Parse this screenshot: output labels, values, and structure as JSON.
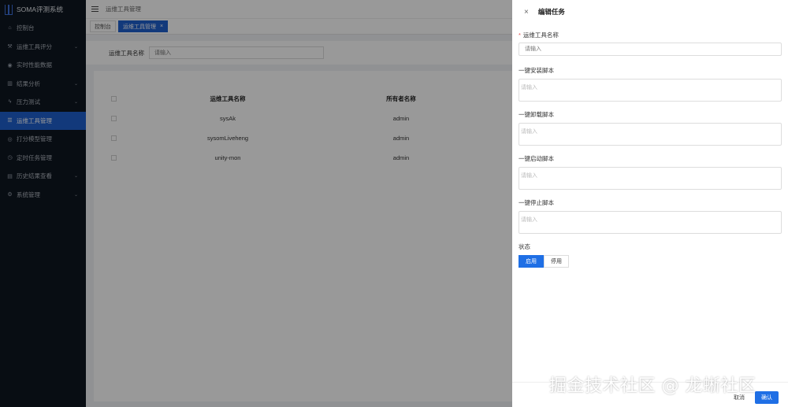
{
  "sidebar": {
    "title": "SOMA评测系统",
    "items": [
      {
        "label": "控制台",
        "icon": "home-icon",
        "glyph": "⌂",
        "expandable": false,
        "active": false
      },
      {
        "label": "运维工具评分",
        "icon": "tool-icon",
        "glyph": "⚒",
        "expandable": true,
        "active": false
      },
      {
        "label": "实时性能数据",
        "icon": "monitor-icon",
        "glyph": "◉",
        "expandable": false,
        "active": false
      },
      {
        "label": "结果分析",
        "icon": "chart-icon",
        "glyph": "▥",
        "expandable": true,
        "active": false
      },
      {
        "label": "压力测试",
        "icon": "bolt-icon",
        "glyph": "ϟ",
        "expandable": true,
        "active": false
      },
      {
        "label": "运维工具管理",
        "icon": "list-icon",
        "glyph": "☰",
        "expandable": false,
        "active": true
      },
      {
        "label": "打分模型管理",
        "icon": "model-icon",
        "glyph": "◎",
        "expandable": false,
        "active": false
      },
      {
        "label": "定时任务管理",
        "icon": "clock-icon",
        "glyph": "◷",
        "expandable": false,
        "active": false
      },
      {
        "label": "历史结果查看",
        "icon": "history-icon",
        "glyph": "▤",
        "expandable": true,
        "active": false
      },
      {
        "label": "系统管理",
        "icon": "settings-icon",
        "glyph": "⚙",
        "expandable": true,
        "active": false
      }
    ]
  },
  "header": {
    "breadcrumb": "运维工具管理"
  },
  "tabs": [
    {
      "label": "控制台",
      "active": false
    },
    {
      "label": "运维工具管理",
      "active": true,
      "close": "×"
    }
  ],
  "filter": {
    "label": "运维工具名称",
    "placeholder": "请输入"
  },
  "table": {
    "columns": [
      "运维工具名称",
      "所有者名称"
    ],
    "rows": [
      {
        "name": "sysAk",
        "owner": "admin"
      },
      {
        "name": "sysomLiveheng",
        "owner": "admin"
      },
      {
        "name": "unity-mon",
        "owner": "admin"
      }
    ]
  },
  "drawer": {
    "close": "×",
    "title": "编辑任务",
    "tool_name_label": "运维工具名称",
    "required_mark": "*",
    "tool_name_placeholder": "请输入",
    "install_label": "一键安装脚本",
    "install_placeholder": "请输入",
    "uninstall_label": "一键卸载脚本",
    "uninstall_placeholder": "请输入",
    "start_label": "一键启动脚本",
    "start_placeholder": "请输入",
    "stop_label": "一键停止脚本",
    "stop_placeholder": "请输入",
    "status_label": "状态",
    "status_options": [
      "启用",
      "停用"
    ],
    "status_selected": "启用",
    "cancel": "取消",
    "confirm": "确认"
  },
  "watermark": "掘金技术社区 @ 龙蜥社区",
  "colors": {
    "sidebar_bg": "#0e1621",
    "accent": "#1f6fe5",
    "active_menu": "#1f5fce",
    "required": "#e34d4d"
  }
}
